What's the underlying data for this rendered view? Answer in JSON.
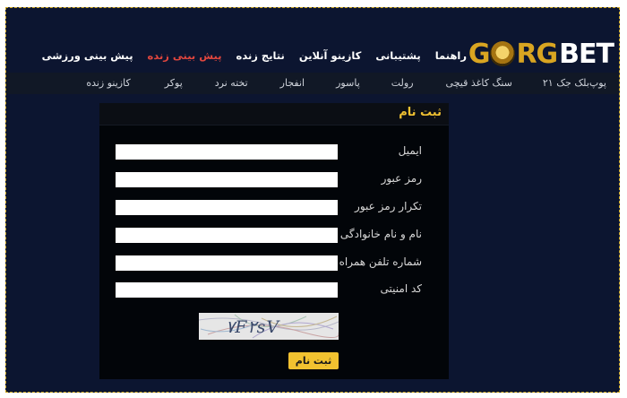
{
  "brand": {
    "left": "G",
    "middle": "RG",
    "right": "BET"
  },
  "main_nav": [
    {
      "label": "پیش بینی ورزشی",
      "active": false
    },
    {
      "label": "پیش بینی زنده",
      "active": true
    },
    {
      "label": "نتایج زنده",
      "active": false
    },
    {
      "label": "کازینو آنلاین",
      "active": false
    },
    {
      "label": "پشتیبانی",
      "active": false
    },
    {
      "label": "راهنما",
      "active": false
    }
  ],
  "sub_nav": [
    "کازینو زنده",
    "پوکر",
    "تخته نرد",
    "انفجار",
    "پاسور",
    "رولت",
    "سنگ کاغذ قیچی",
    "بلک جک ۲۱",
    "پوپ"
  ],
  "form": {
    "title": "ثبت نام",
    "fields": [
      {
        "label": "ایمیل",
        "value": ""
      },
      {
        "label": "رمز عبور",
        "value": ""
      },
      {
        "label": "تکرار رمز عبور",
        "value": ""
      },
      {
        "label": "نام و نام خانوادگی",
        "value": ""
      },
      {
        "label": "شماره تلفن همراه",
        "value": ""
      },
      {
        "label": "کد امنیتی",
        "value": ""
      }
    ],
    "captcha_code": "۷F۲sV",
    "submit_label": "ثبت نام"
  },
  "colors": {
    "background": "#0c1530",
    "accent": "#f2c230",
    "active_nav": "#e0463e",
    "panel": "#020509"
  }
}
